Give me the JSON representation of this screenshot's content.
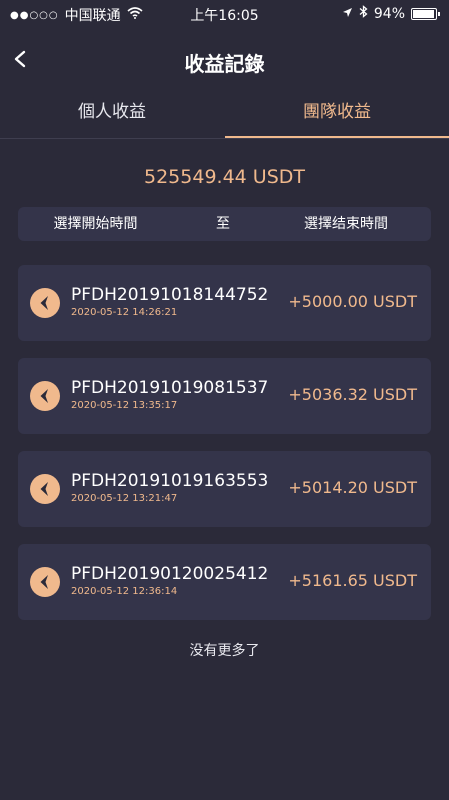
{
  "status_bar": {
    "signal": "●●○○○",
    "carrier": "中国联通",
    "wifi_icon": "wifi-icon",
    "time": "上午16:05",
    "location_icon": "location-arrow-icon",
    "bluetooth_icon": "bluetooth-icon",
    "battery": "94%"
  },
  "header": {
    "back_icon": "chevron-left-icon",
    "title": "收益記錄"
  },
  "tabs": [
    {
      "label": "個人收益",
      "active": false
    },
    {
      "label": "團隊收益",
      "active": true
    }
  ],
  "total": "525549.44 USDT",
  "date_filter": {
    "start": "選擇開始時間",
    "separator": "至",
    "end": "選擇结束時間"
  },
  "records": [
    {
      "id": "PFDH20191018144752",
      "time": "2020-05-12  14:26:21",
      "amount": "+5000.00 USDT"
    },
    {
      "id": "PFDH20191019081537",
      "time": "2020-05-12  13:35:17",
      "amount": "+5036.32 USDT"
    },
    {
      "id": "PFDH20191019163553",
      "time": "2020-05-12  13:21:47",
      "amount": "+5014.20 USDT"
    },
    {
      "id": "PFDH20190120025412",
      "time": "2020-05-12  12:36:14",
      "amount": "+5161.65 USDT"
    }
  ],
  "footer": {
    "no_more": "没有更多了"
  },
  "colors": {
    "background": "#2b2a39",
    "card": "#34344a",
    "accent": "#f0b98d",
    "text": "#ffffff"
  }
}
